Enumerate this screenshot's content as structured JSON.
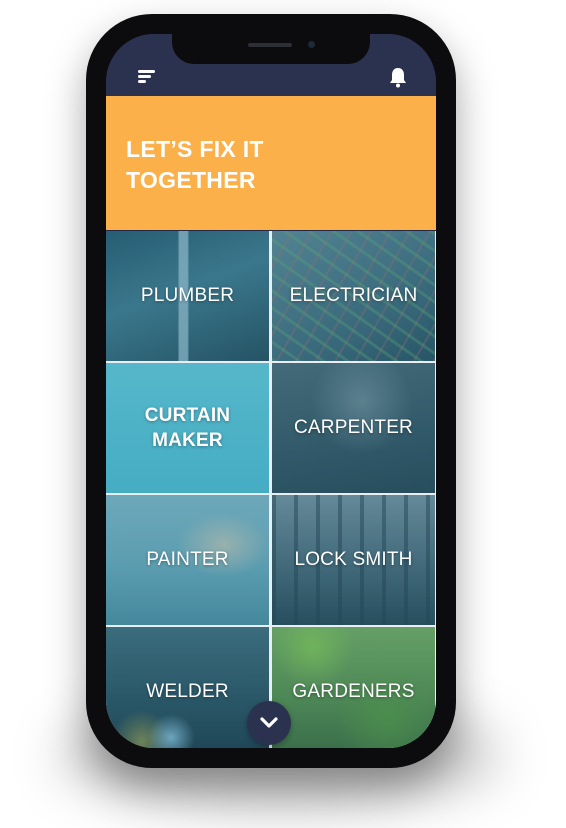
{
  "header": {
    "menu_icon": "menu-icon",
    "notification_icon": "bell-icon",
    "background_color": "#2b3250"
  },
  "hero": {
    "title": "LET’S FIX IT\nTOGETHER",
    "background_color": "#fcb049"
  },
  "services": [
    {
      "label": "PLUMBER"
    },
    {
      "label": "ELECTRICIAN"
    },
    {
      "label": "CURTAIN\nMAKER"
    },
    {
      "label": "CARPENTER"
    },
    {
      "label": "PAINTER"
    },
    {
      "label": "LOCK SMITH"
    },
    {
      "label": "WELDER"
    },
    {
      "label": "GARDENERS"
    }
  ],
  "scroll_button": {
    "icon": "chevron-down-icon"
  }
}
